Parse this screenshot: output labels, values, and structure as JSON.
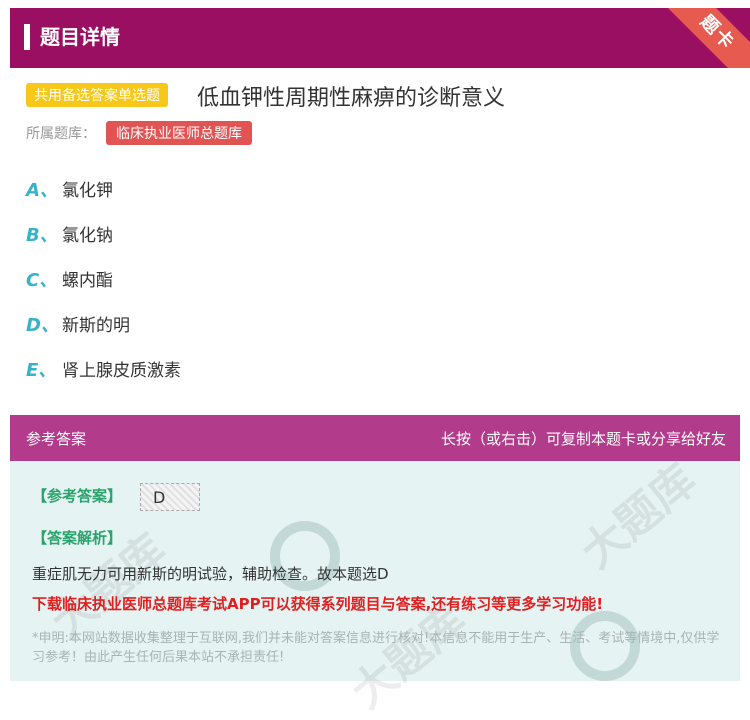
{
  "header": {
    "title": "题目详情",
    "ribbon": "题卡"
  },
  "question": {
    "type_badge": "共用备选答案单选题",
    "title": "低血钾性周期性麻痹的诊断意义",
    "bank_label": "所属题库：",
    "bank_name": "临床执业医师总题库"
  },
  "options": [
    {
      "letter": "A、",
      "text": "氯化钾"
    },
    {
      "letter": "B、",
      "text": "氯化钠"
    },
    {
      "letter": "C、",
      "text": "螺内酯"
    },
    {
      "letter": "D、",
      "text": "新斯的明"
    },
    {
      "letter": "E、",
      "text": "肾上腺皮质激素"
    }
  ],
  "answer_bar": {
    "left": "参考答案",
    "right": "长按（或右击）可复制本题卡或分享给好友"
  },
  "answer": {
    "answer_label": "【参考答案】",
    "answer_value": "D",
    "analysis_label": "【答案解析】",
    "analysis_text": "重症肌无力可用新斯的明试验，辅助检查。故本题选D",
    "promo": "下载临床执业医师总题库考试APP可以获得系列题目与答案,还有练习等更多学习功能!",
    "disclaimer": "*申明:本网站数据收集整理于互联网,我们并未能对答案信息进行核对!本信息不能用于生产、生活、考试等情境中,仅供学习参考！由此产生任何后果本站不承担责任!"
  }
}
